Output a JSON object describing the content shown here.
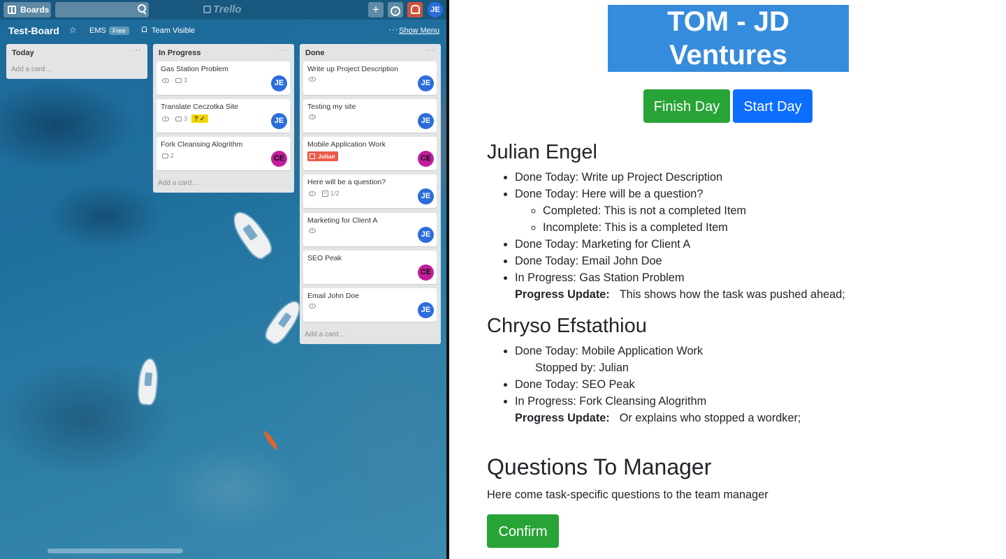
{
  "trello": {
    "topbar": {
      "boards_label": "Boards",
      "logo": "Trello",
      "avatar": "JE"
    },
    "board": {
      "title": "Test-Board",
      "team": "EMS",
      "team_badge": "Free",
      "visibility": "Team Visible",
      "menu_label": "Show Menu"
    },
    "lists": [
      {
        "title": "Today",
        "add_card": "Add a card…",
        "cards": []
      },
      {
        "title": "In Progress",
        "add_card": "Add a card…",
        "cards": [
          {
            "title": "Gas Station Problem",
            "comments": "3",
            "avatar": "JE"
          },
          {
            "title": "Translate Ceczotka Site",
            "comments": "3",
            "label": "? ✓",
            "avatar": "JE"
          },
          {
            "title": "Fork Cleansing Alogrithm",
            "comments": "2",
            "avatar": "CE"
          }
        ]
      },
      {
        "title": "Done",
        "add_card": "Add a card…",
        "cards": [
          {
            "title": "Write up Project Description",
            "avatar": "JE"
          },
          {
            "title": "Testing my site",
            "avatar": "JE"
          },
          {
            "title": "Mobile Application Work",
            "label": "Julian",
            "avatar": "CE"
          },
          {
            "title": "Here will be a question?",
            "checklist": "1/2",
            "avatar": "JE"
          },
          {
            "title": "Marketing for Client A",
            "avatar": "JE"
          },
          {
            "title": "SEO Peak",
            "avatar": "CE"
          },
          {
            "title": "Email John Doe",
            "avatar": "JE"
          }
        ]
      }
    ]
  },
  "report": {
    "title": "TOM - JD Ventures",
    "finish_day": "Finish Day",
    "start_day": "Start Day",
    "people": [
      {
        "name": "Julian Engel",
        "items": [
          "Done Today: Write up Project Description",
          "Done Today: Here will be a question?",
          "Done Today: Marketing for Client A",
          "Done Today: Email John Doe",
          "In Progress: Gas Station Problem"
        ],
        "subitems": [
          "Completed: This is not a completed Item",
          "Incomplete: This is a completed Item"
        ],
        "progress_label": "Progress Update:",
        "progress_text": "This shows how the task was pushed ahead;"
      },
      {
        "name": "Chryso Efstathiou",
        "items": [
          "Done Today: Mobile Application Work",
          "Done Today: SEO Peak",
          "In Progress: Fork Cleansing Alogrithm"
        ],
        "stopped_by": "Stopped by: Julian",
        "progress_label": "Progress Update:",
        "progress_text": "Or explains who stopped a wordker;"
      }
    ],
    "questions_heading": "Questions To Manager",
    "questions_text": "Here come task-specific questions to the team manager",
    "confirm": "Confirm"
  },
  "colors": {
    "brand_blue": "#368cdc",
    "finish_green": "#28a336",
    "start_blue": "#0d6efd",
    "member_je": "#2b6ddb",
    "member_ce": "#c21e9c",
    "label_yellow": "#f2d600",
    "label_red": "#eb5a46"
  }
}
